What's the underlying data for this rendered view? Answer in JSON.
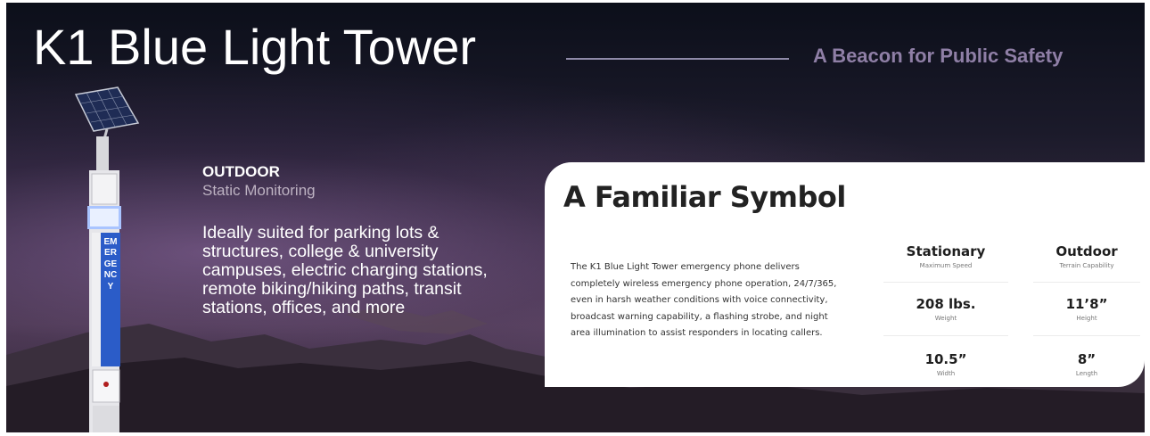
{
  "header": {
    "title": "K1 Blue Light Tower",
    "tagline": "A Beacon for Public Safety"
  },
  "intro": {
    "heading": "OUTDOOR",
    "subheading": "Static Monitoring",
    "body": "Ideally suited for parking lots & structures, college & university campuses, electric charging stations, remote biking/hiking paths, transit stations, offices, and more"
  },
  "tower": {
    "vertical_label": "EMERGENCY",
    "accent_color": "#2b5cc8"
  },
  "card": {
    "title": "A Familiar Symbol",
    "description": "The K1 Blue Light Tower emergency phone delivers completely wireless emergency phone operation, 24/7/365, even in harsh weather conditions with voice connectivity, broadcast warning capability, a flashing strobe, and night area illumination to assist responders in locating callers.",
    "stats": [
      {
        "value": "Stationary",
        "label": "Maximum Speed"
      },
      {
        "value": "Outdoor",
        "label": "Terrain Capability"
      },
      {
        "value": "208 lbs.",
        "label": "Weight"
      },
      {
        "value": "11’8”",
        "label": "Height"
      },
      {
        "value": "10.5”",
        "label": "Width"
      },
      {
        "value": "8”",
        "label": "Length"
      }
    ]
  },
  "colors": {
    "tagline": "#8f7fa6",
    "card_background": "#ffffff",
    "title_text": "#ffffff"
  }
}
